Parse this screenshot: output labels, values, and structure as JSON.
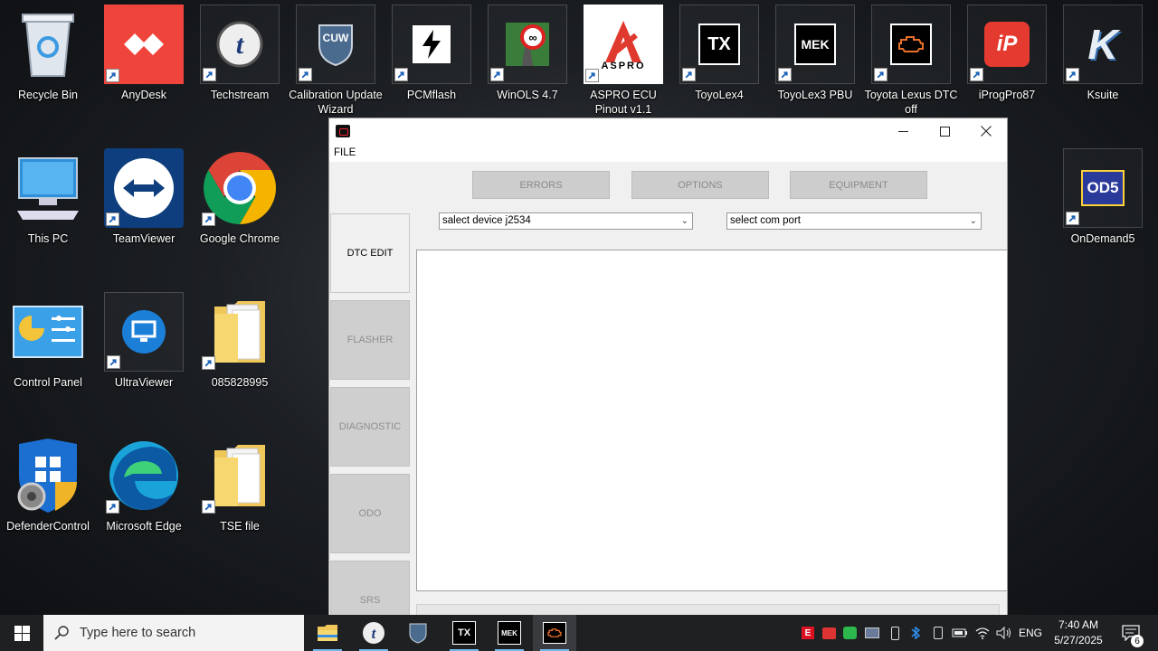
{
  "desktop": {
    "icons": [
      {
        "label": "Recycle Bin"
      },
      {
        "label": "AnyDesk"
      },
      {
        "label": "Techstream"
      },
      {
        "label": "Calibration Update Wizard",
        "tile_text": "CUW"
      },
      {
        "label": "PCMflash"
      },
      {
        "label": "WinOLS 4.7"
      },
      {
        "label": "ASPRO ECU Pinout v1.1",
        "tile_text": "ASPRO"
      },
      {
        "label": "ToyoLex4",
        "tile_text": "TX"
      },
      {
        "label": "ToyoLex3 PBU",
        "tile_text": "MEK"
      },
      {
        "label": "Toyota Lexus DTC off"
      },
      {
        "label": "iProgPro87",
        "tile_text": "iP"
      },
      {
        "label": "Ksuite",
        "tile_text": "K"
      },
      {
        "label": "This PC"
      },
      {
        "label": "TeamViewer"
      },
      {
        "label": "Google Chrome"
      },
      {
        "label": "OnDemand5",
        "tile_text": "OD5"
      },
      {
        "label": "Control Panel"
      },
      {
        "label": "UltraViewer"
      },
      {
        "label": "085828995"
      },
      {
        "label": "DefenderControl"
      },
      {
        "label": "Microsoft Edge"
      },
      {
        "label": "TSE file"
      }
    ]
  },
  "window": {
    "menu": {
      "file": "FILE"
    },
    "top_buttons": {
      "errors": "ERRORS",
      "options": "OPTIONS",
      "equipment": "EQUIPMENT"
    },
    "device_select": {
      "value": "salect device j2534"
    },
    "port_select": {
      "value": "select com port"
    },
    "side_tabs": [
      {
        "label": "DTC EDIT",
        "active": true
      },
      {
        "label": "FLASHER",
        "active": false
      },
      {
        "label": "DIAGNOSTIC",
        "active": false
      },
      {
        "label": "ODO",
        "active": false
      },
      {
        "label": "SRS",
        "active": false
      }
    ]
  },
  "taskbar": {
    "search_placeholder": "Type here to search",
    "tb_tile_texts": {
      "techstream": "t",
      "toyolex": "TX",
      "mek": "MEK"
    },
    "language": "ENG",
    "time": "7:40 AM",
    "date": "5/27/2025",
    "notifications": "6"
  }
}
